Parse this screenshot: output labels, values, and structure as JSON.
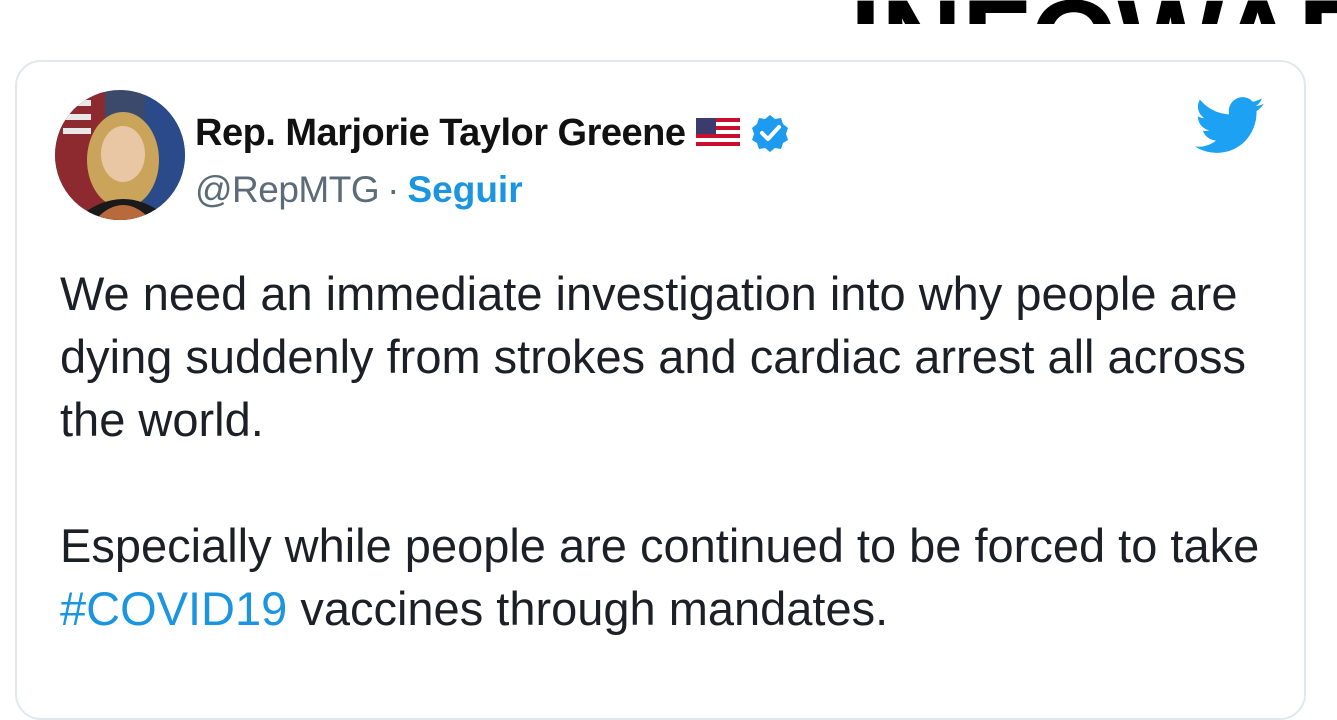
{
  "header": {
    "logo_text": "INFOWARS"
  },
  "tweet": {
    "display_name": "Rep. Marjorie Taylor Greene",
    "handle": "@RepMTG",
    "separator": "·",
    "follow_label": "Seguir",
    "paragraph_1": "We need an immediate investigation into why people are dying suddenly from strokes and cardiac arrest all across the world.",
    "paragraph_2_before": "Especially while people are continued to be forced to take ",
    "hashtag": "#COVID19",
    "paragraph_2_after": " vaccines through mandates."
  },
  "icons": {
    "avatar": "profile-photo",
    "flag": "us-flag-icon",
    "verified": "verified-badge-icon",
    "brand": "twitter-bird-icon"
  },
  "colors": {
    "link_blue": "#1b95e0",
    "verified_blue": "#1d9bf0",
    "twitter_blue": "#1da1f2",
    "text": "#1c2026",
    "muted": "#5b6b78",
    "card_border": "#e1e8ed"
  }
}
